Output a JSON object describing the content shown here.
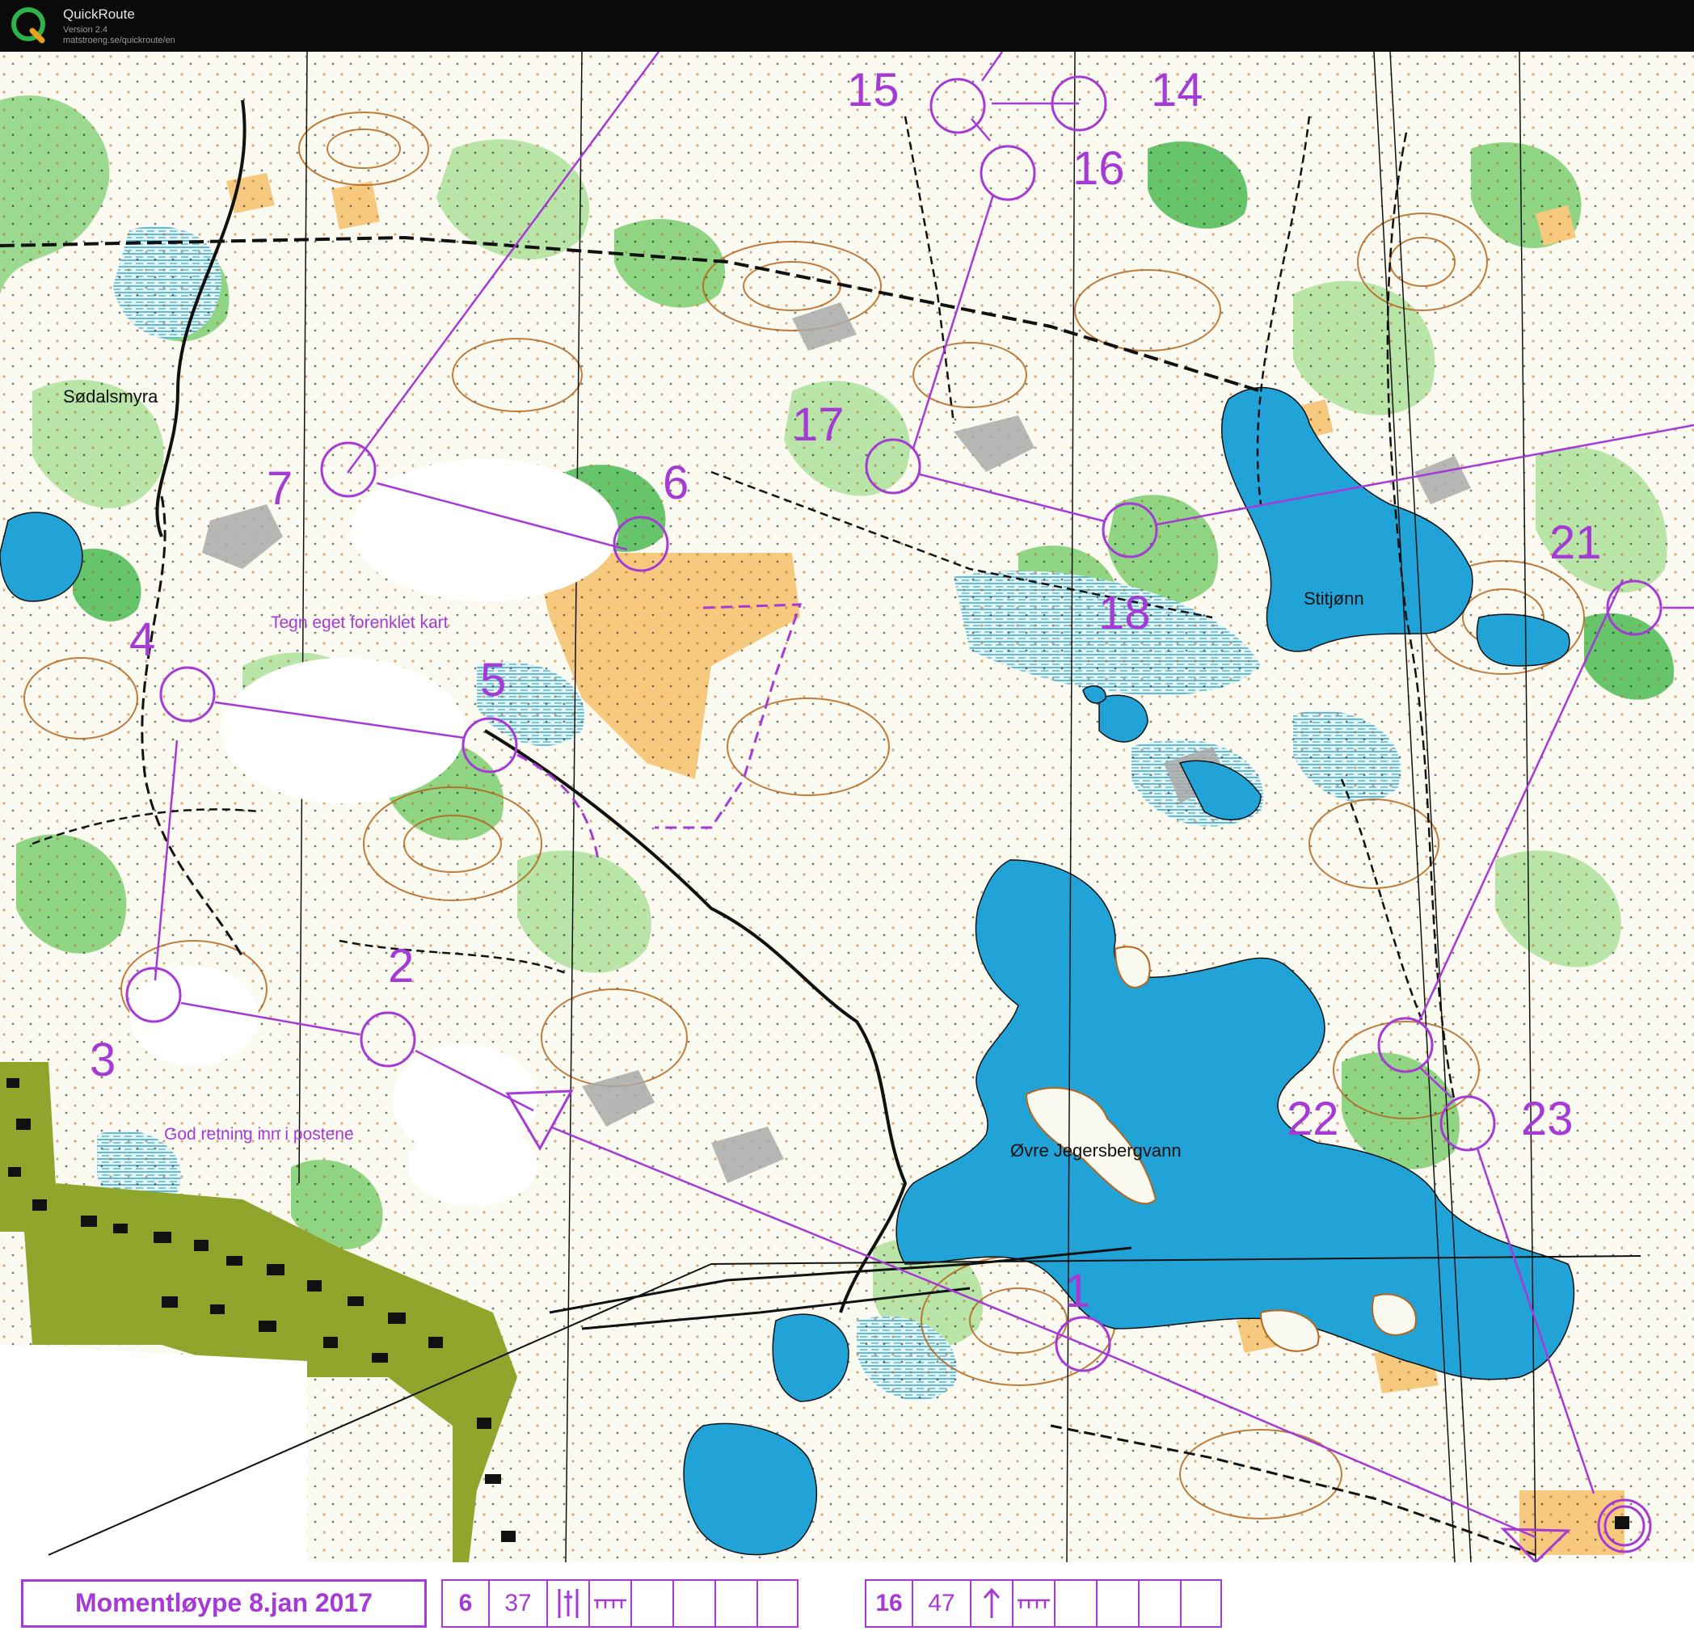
{
  "app": {
    "name": "QuickRoute",
    "version": "Version 2.4",
    "url": "matstroeng.se/quickroute/en"
  },
  "map": {
    "place_names": {
      "sodalsmyra": "Sødalsmyra",
      "stitjonn": "Stitjønn",
      "ovre_jegersbergvann": "Øvre Jegersbergvann"
    },
    "annotations": {
      "simplified_map": "Tegn eget forenklet kart",
      "good_direction": "God retning inn i postene"
    },
    "control_labels": [
      "1",
      "2",
      "3",
      "4",
      "5",
      "6",
      "7",
      "14",
      "15",
      "16",
      "17",
      "18",
      "21",
      "22",
      "23"
    ],
    "colors": {
      "course": "#a63ad6",
      "forest_white": "#fbfaf0",
      "open_land": "#f6c97f",
      "green_vegetation": "#66c46a",
      "light_green": "#b9e5a9",
      "water": "#22a3d8",
      "contour": "#b5651d",
      "settlement": "#8fa52b",
      "building": "#111111",
      "path": "#111111"
    }
  },
  "footer": {
    "title": "Momentløype 8.jan 2017",
    "descriptions": [
      {
        "number": "6",
        "code": "37",
        "symbol": "hill-between-lines-icon",
        "dim": "fence-icon"
      },
      {
        "number": "16",
        "code": "47",
        "symbol": "up-arrow-icon",
        "dim": "fence-icon"
      }
    ]
  }
}
